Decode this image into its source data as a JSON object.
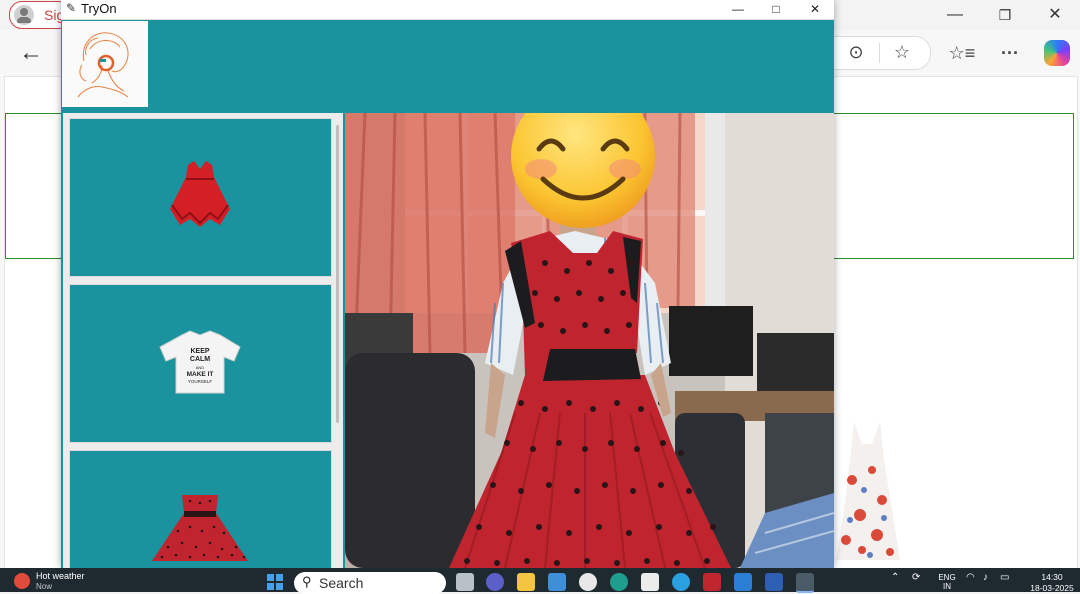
{
  "browser": {
    "profile_label": "Sig",
    "back_glyph": "←",
    "win_min": "—",
    "win_restore": "❐",
    "win_close": "✕",
    "more_glyph": "⋯",
    "reading_glyph": "⊙",
    "favorite_glyph": "☆",
    "favorites_glyph": "☆≡",
    "menu_glyph": "···"
  },
  "app": {
    "title": "TryOn",
    "title_icon": "feather",
    "min": "—",
    "max": "□",
    "close": "✕",
    "logo_letter": "O",
    "garments": [
      {
        "name": "red-ruffle-dress"
      },
      {
        "name": "keep-calm-tshirt",
        "print_text": "KEEP CALM AND MAKE IT YOURSELF"
      },
      {
        "name": "red-polka-dress"
      }
    ]
  },
  "taskbar": {
    "weather_title": "Hot weather",
    "weather_sub": "Now",
    "search_label": "Search",
    "lang_top": "ENG",
    "lang_bottom": "IN",
    "time": "14:30",
    "date": "18-03-2025"
  },
  "colors": {
    "app_bg": "#1a939e",
    "dress_red": "#c0252f",
    "polka": "#2a1416"
  }
}
